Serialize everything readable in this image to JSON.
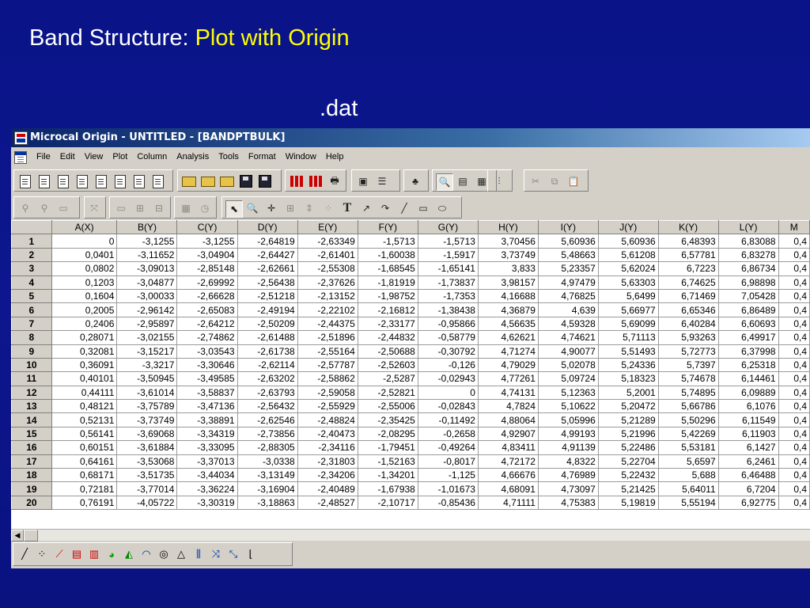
{
  "slide": {
    "title_prefix": "Band Structure: ",
    "title_accent": "Plot with Origin",
    "subtitle": ".dat"
  },
  "window": {
    "title": "Microcal Origin - UNTITLED - [BANDPTBULK]"
  },
  "menu": [
    "File",
    "Edit",
    "View",
    "Plot",
    "Column",
    "Analysis",
    "Tools",
    "Format",
    "Window",
    "Help"
  ],
  "toolbar_text_tool": "T",
  "worksheet": {
    "columns": [
      "A(X)",
      "B(Y)",
      "C(Y)",
      "D(Y)",
      "E(Y)",
      "F(Y)",
      "G(Y)",
      "H(Y)",
      "I(Y)",
      "J(Y)",
      "K(Y)",
      "L(Y)",
      "M"
    ],
    "rows": [
      {
        "n": "1",
        "v": [
          "0",
          "-3,1255",
          "-3,1255",
          "-2,64819",
          "-2,63349",
          "-1,5713",
          "-1,5713",
          "3,70456",
          "5,60936",
          "5,60936",
          "6,48393",
          "6,83088",
          "0,4"
        ]
      },
      {
        "n": "2",
        "v": [
          "0,0401",
          "-3,11652",
          "-3,04904",
          "-2,64427",
          "-2,61401",
          "-1,60038",
          "-1,5917",
          "3,73749",
          "5,48663",
          "5,61208",
          "6,57781",
          "6,83278",
          "0,4"
        ]
      },
      {
        "n": "3",
        "v": [
          "0,0802",
          "-3,09013",
          "-2,85148",
          "-2,62661",
          "-2,55308",
          "-1,68545",
          "-1,65141",
          "3,833",
          "5,23357",
          "5,62024",
          "6,7223",
          "6,86734",
          "0,4"
        ]
      },
      {
        "n": "4",
        "v": [
          "0,1203",
          "-3,04877",
          "-2,69992",
          "-2,56438",
          "-2,37626",
          "-1,81919",
          "-1,73837",
          "3,98157",
          "4,97479",
          "5,63303",
          "6,74625",
          "6,98898",
          "0,4"
        ]
      },
      {
        "n": "5",
        "v": [
          "0,1604",
          "-3,00033",
          "-2,66628",
          "-2,51218",
          "-2,13152",
          "-1,98752",
          "-1,7353",
          "4,16688",
          "4,76825",
          "5,6499",
          "6,71469",
          "7,05428",
          "0,4"
        ]
      },
      {
        "n": "6",
        "v": [
          "0,2005",
          "-2,96142",
          "-2,65083",
          "-2,49194",
          "-2,22102",
          "-2,16812",
          "-1,38438",
          "4,36879",
          "4,639",
          "5,66977",
          "6,65346",
          "6,86489",
          "0,4"
        ]
      },
      {
        "n": "7",
        "v": [
          "0,2406",
          "-2,95897",
          "-2,64212",
          "-2,50209",
          "-2,44375",
          "-2,33177",
          "-0,95866",
          "4,56635",
          "4,59328",
          "5,69099",
          "6,40284",
          "6,60693",
          "0,4"
        ]
      },
      {
        "n": "8",
        "v": [
          "0,28071",
          "-3,02155",
          "-2,74862",
          "-2,61488",
          "-2,51896",
          "-2,44832",
          "-0,58779",
          "4,62621",
          "4,74621",
          "5,71113",
          "5,93263",
          "6,49917",
          "0,4"
        ]
      },
      {
        "n": "9",
        "v": [
          "0,32081",
          "-3,15217",
          "-3,03543",
          "-2,61738",
          "-2,55164",
          "-2,50688",
          "-0,30792",
          "4,71274",
          "4,90077",
          "5,51493",
          "5,72773",
          "6,37998",
          "0,4"
        ]
      },
      {
        "n": "10",
        "v": [
          "0,36091",
          "-3,3217",
          "-3,30646",
          "-2,62114",
          "-2,57787",
          "-2,52603",
          "-0,126",
          "4,79029",
          "5,02078",
          "5,24336",
          "5,7397",
          "6,25318",
          "0,4"
        ]
      },
      {
        "n": "11",
        "v": [
          "0,40101",
          "-3,50945",
          "-3,49585",
          "-2,63202",
          "-2,58862",
          "-2,5287",
          "-0,02943",
          "4,77261",
          "5,09724",
          "5,18323",
          "5,74678",
          "6,14461",
          "0,4"
        ]
      },
      {
        "n": "12",
        "v": [
          "0,44111",
          "-3,61014",
          "-3,58837",
          "-2,63793",
          "-2,59058",
          "-2,52821",
          "0",
          "4,74131",
          "5,12363",
          "5,2001",
          "5,74895",
          "6,09889",
          "0,4"
        ]
      },
      {
        "n": "13",
        "v": [
          "0,48121",
          "-3,75789",
          "-3,47136",
          "-2,56432",
          "-2,55929",
          "-2,55006",
          "-0,02843",
          "4,7824",
          "5,10622",
          "5,20472",
          "5,66786",
          "6,1076",
          "0,4"
        ]
      },
      {
        "n": "14",
        "v": [
          "0,52131",
          "-3,73749",
          "-3,38891",
          "-2,62546",
          "-2,48824",
          "-2,35425",
          "-0,11492",
          "4,88064",
          "5,05996",
          "5,21289",
          "5,50296",
          "6,11549",
          "0,4"
        ]
      },
      {
        "n": "15",
        "v": [
          "0,56141",
          "-3,69068",
          "-3,34319",
          "-2,73856",
          "-2,40473",
          "-2,08295",
          "-0,2658",
          "4,92907",
          "4,99193",
          "5,21996",
          "5,42269",
          "6,11903",
          "0,4"
        ]
      },
      {
        "n": "16",
        "v": [
          "0,60151",
          "-3,61884",
          "-3,33095",
          "-2,88305",
          "-2,34116",
          "-1,79451",
          "-0,49264",
          "4,83411",
          "4,91139",
          "5,22486",
          "5,53181",
          "6,1427",
          "0,4"
        ]
      },
      {
        "n": "17",
        "v": [
          "0,64161",
          "-3,53068",
          "-3,37013",
          "-3,0338",
          "-2,31803",
          "-1,52163",
          "-0,8017",
          "4,72172",
          "4,8322",
          "5,22704",
          "5,6597",
          "6,2461",
          "0,4"
        ]
      },
      {
        "n": "18",
        "v": [
          "0,68171",
          "-3,51735",
          "-3,44034",
          "-3,13149",
          "-2,34206",
          "-1,34201",
          "-1,125",
          "4,66676",
          "4,76989",
          "5,22432",
          "5,688",
          "6,46488",
          "0,4"
        ]
      },
      {
        "n": "19",
        "v": [
          "0,72181",
          "-3,77014",
          "-3,36224",
          "-3,16904",
          "-2,40489",
          "-1,67938",
          "-1,01673",
          "4,68091",
          "4,73097",
          "5,21425",
          "5,64011",
          "6,7204",
          "0,4"
        ]
      },
      {
        "n": "20",
        "v": [
          "0,76191",
          "-4,05722",
          "-3,30319",
          "-3,18863",
          "-2,48527",
          "-2,10717",
          "-0,85436",
          "4,71111",
          "4,75383",
          "5,19819",
          "5,55194",
          "6,92775",
          "0,4"
        ]
      }
    ]
  }
}
